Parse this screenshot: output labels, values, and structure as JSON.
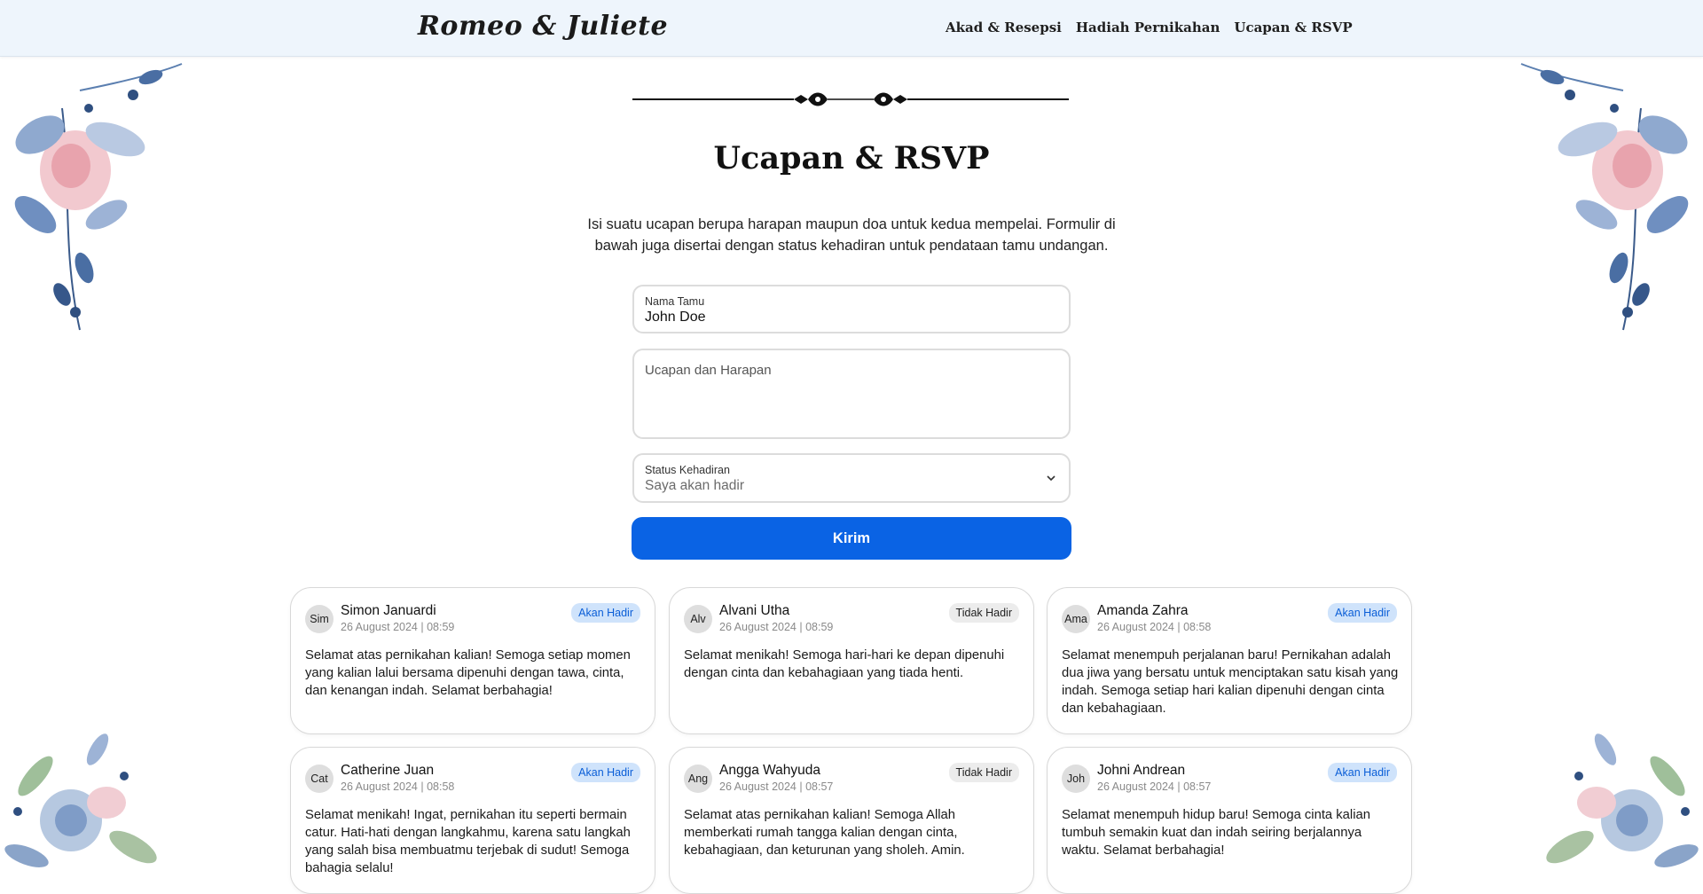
{
  "nav": {
    "brand": "Romeo & Juliete",
    "links": [
      "Akad & Resepsi",
      "Hadiah Pernikahan",
      "Ucapan & RSVP"
    ]
  },
  "section": {
    "title": "Ucapan & RSVP",
    "description": "Isi suatu ucapan berupa harapan maupun doa untuk kedua mempelai. Formulir di bawah juga disertai dengan status kehadiran untuk pendataan tamu undangan."
  },
  "form": {
    "name_label": "Nama Tamu",
    "name_value": "John Doe",
    "message_placeholder": "Ucapan dan Harapan",
    "status_label": "Status Kehadiran",
    "status_value": "Saya akan hadir",
    "submit_label": "Kirim"
  },
  "colors": {
    "accent": "#0a63e4",
    "badge_yes_bg": "#cfe3fb",
    "badge_yes_text": "#0a5ed7",
    "badge_no_bg": "#ececec",
    "nav_bg": "#eef5fc"
  },
  "wishes": [
    {
      "initials": "Sim",
      "name": "Simon Januardi",
      "date": "26 August 2024 | 08:59",
      "status": "Akan Hadir",
      "message": "Selamat atas pernikahan kalian! Semoga setiap momen yang kalian lalui bersama dipenuhi dengan tawa, cinta, dan kenangan indah. Selamat berbahagia!"
    },
    {
      "initials": "Alv",
      "name": "Alvani Utha",
      "date": "26 August 2024 | 08:59",
      "status": "Tidak Hadir",
      "message": "Selamat menikah! Semoga hari-hari ke depan dipenuhi dengan cinta dan kebahagiaan yang tiada henti."
    },
    {
      "initials": "Ama",
      "name": "Amanda Zahra",
      "date": "26 August 2024 | 08:58",
      "status": "Akan Hadir",
      "message": "Selamat menempuh perjalanan baru! Pernikahan adalah dua jiwa yang bersatu untuk menciptakan satu kisah yang indah. Semoga setiap hari kalian dipenuhi dengan cinta dan kebahagiaan."
    },
    {
      "initials": "Cat",
      "name": "Catherine Juan",
      "date": "26 August 2024 | 08:58",
      "status": "Akan Hadir",
      "message": "Selamat menikah! Ingat, pernikahan itu seperti bermain catur. Hati-hati dengan langkahmu, karena satu langkah yang salah bisa membuatmu terjebak di sudut! Semoga bahagia selalu!"
    },
    {
      "initials": "Ang",
      "name": "Angga Wahyuda",
      "date": "26 August 2024 | 08:57",
      "status": "Tidak Hadir",
      "message": "Selamat atas pernikahan kalian! Semoga Allah memberkati rumah tangga kalian dengan cinta, kebahagiaan, dan keturunan yang sholeh. Amin."
    },
    {
      "initials": "Joh",
      "name": "Johni Andrean",
      "date": "26 August 2024 | 08:57",
      "status": "Akan Hadir",
      "message": "Selamat menempuh hidup baru! Semoga cinta kalian tumbuh semakin kuat dan indah seiring berjalannya waktu. Selamat berbahagia!"
    }
  ]
}
